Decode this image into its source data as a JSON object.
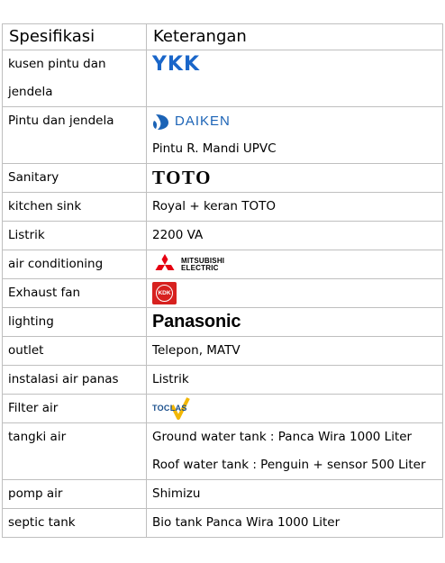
{
  "header": {
    "col1": "Spesifikasi",
    "col2": "Keterangan"
  },
  "rows": [
    {
      "label_lines": [
        "kusen pintu dan",
        "jendela"
      ],
      "logo": {
        "name": "ykk-logo",
        "text": "YKK",
        "color": "#1a66c9"
      }
    },
    {
      "label": "Pintu dan jendela",
      "logo": {
        "name": "daiken-logo",
        "text": "DAIKEN",
        "color": "#1b63b6"
      },
      "value": "Pintu R. Mandi UPVC"
    },
    {
      "label": "Sanitary",
      "logo": {
        "name": "toto-logo",
        "text": "TOTO"
      }
    },
    {
      "label": "kitchen sink",
      "value": "Royal + keran TOTO"
    },
    {
      "label": "Listrik",
      "value": "2200 VA"
    },
    {
      "label": "air conditioning",
      "logo": {
        "name": "mitsubishi-electric-logo",
        "text_lines": [
          "MITSUBISHI",
          "ELECTRIC"
        ],
        "color": "#e60012"
      }
    },
    {
      "label": "Exhaust fan",
      "logo": {
        "name": "kdk-logo",
        "text": "KDK",
        "color": "#d7211f"
      }
    },
    {
      "label": "lighting",
      "logo": {
        "name": "panasonic-logo",
        "text": "Panasonic"
      }
    },
    {
      "label": "outlet",
      "value": "Telepon, MATV"
    },
    {
      "label": "instalasi air panas",
      "value": "Listrik"
    },
    {
      "label": "Filter air",
      "logo": {
        "name": "toclas-logo",
        "text": "TOCLAS",
        "color": "#1a4f8c",
        "accent": "#f2b705"
      }
    },
    {
      "label": "tangki air",
      "value_lines": [
        "Ground water tank : Panca Wira 1000 Liter",
        "Roof water tank : Penguin + sensor 500 Liter"
      ]
    },
    {
      "label": "pomp air",
      "value": "Shimizu"
    },
    {
      "label": "septic tank",
      "value": "Bio tank Panca Wira 1000 Liter"
    }
  ]
}
